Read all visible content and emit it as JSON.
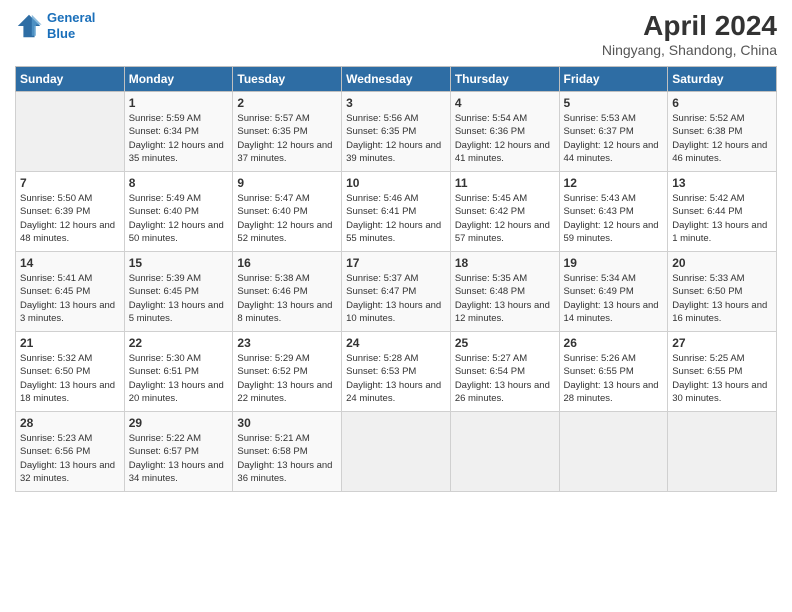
{
  "header": {
    "logo_line1": "General",
    "logo_line2": "Blue",
    "month_year": "April 2024",
    "location": "Ningyang, Shandong, China"
  },
  "weekdays": [
    "Sunday",
    "Monday",
    "Tuesday",
    "Wednesday",
    "Thursday",
    "Friday",
    "Saturday"
  ],
  "weeks": [
    [
      {
        "day": "",
        "empty": true
      },
      {
        "day": "1",
        "sunrise": "Sunrise: 5:59 AM",
        "sunset": "Sunset: 6:34 PM",
        "daylight": "Daylight: 12 hours and 35 minutes."
      },
      {
        "day": "2",
        "sunrise": "Sunrise: 5:57 AM",
        "sunset": "Sunset: 6:35 PM",
        "daylight": "Daylight: 12 hours and 37 minutes."
      },
      {
        "day": "3",
        "sunrise": "Sunrise: 5:56 AM",
        "sunset": "Sunset: 6:35 PM",
        "daylight": "Daylight: 12 hours and 39 minutes."
      },
      {
        "day": "4",
        "sunrise": "Sunrise: 5:54 AM",
        "sunset": "Sunset: 6:36 PM",
        "daylight": "Daylight: 12 hours and 41 minutes."
      },
      {
        "day": "5",
        "sunrise": "Sunrise: 5:53 AM",
        "sunset": "Sunset: 6:37 PM",
        "daylight": "Daylight: 12 hours and 44 minutes."
      },
      {
        "day": "6",
        "sunrise": "Sunrise: 5:52 AM",
        "sunset": "Sunset: 6:38 PM",
        "daylight": "Daylight: 12 hours and 46 minutes."
      }
    ],
    [
      {
        "day": "7",
        "sunrise": "Sunrise: 5:50 AM",
        "sunset": "Sunset: 6:39 PM",
        "daylight": "Daylight: 12 hours and 48 minutes."
      },
      {
        "day": "8",
        "sunrise": "Sunrise: 5:49 AM",
        "sunset": "Sunset: 6:40 PM",
        "daylight": "Daylight: 12 hours and 50 minutes."
      },
      {
        "day": "9",
        "sunrise": "Sunrise: 5:47 AM",
        "sunset": "Sunset: 6:40 PM",
        "daylight": "Daylight: 12 hours and 52 minutes."
      },
      {
        "day": "10",
        "sunrise": "Sunrise: 5:46 AM",
        "sunset": "Sunset: 6:41 PM",
        "daylight": "Daylight: 12 hours and 55 minutes."
      },
      {
        "day": "11",
        "sunrise": "Sunrise: 5:45 AM",
        "sunset": "Sunset: 6:42 PM",
        "daylight": "Daylight: 12 hours and 57 minutes."
      },
      {
        "day": "12",
        "sunrise": "Sunrise: 5:43 AM",
        "sunset": "Sunset: 6:43 PM",
        "daylight": "Daylight: 12 hours and 59 minutes."
      },
      {
        "day": "13",
        "sunrise": "Sunrise: 5:42 AM",
        "sunset": "Sunset: 6:44 PM",
        "daylight": "Daylight: 13 hours and 1 minute."
      }
    ],
    [
      {
        "day": "14",
        "sunrise": "Sunrise: 5:41 AM",
        "sunset": "Sunset: 6:45 PM",
        "daylight": "Daylight: 13 hours and 3 minutes."
      },
      {
        "day": "15",
        "sunrise": "Sunrise: 5:39 AM",
        "sunset": "Sunset: 6:45 PM",
        "daylight": "Daylight: 13 hours and 5 minutes."
      },
      {
        "day": "16",
        "sunrise": "Sunrise: 5:38 AM",
        "sunset": "Sunset: 6:46 PM",
        "daylight": "Daylight: 13 hours and 8 minutes."
      },
      {
        "day": "17",
        "sunrise": "Sunrise: 5:37 AM",
        "sunset": "Sunset: 6:47 PM",
        "daylight": "Daylight: 13 hours and 10 minutes."
      },
      {
        "day": "18",
        "sunrise": "Sunrise: 5:35 AM",
        "sunset": "Sunset: 6:48 PM",
        "daylight": "Daylight: 13 hours and 12 minutes."
      },
      {
        "day": "19",
        "sunrise": "Sunrise: 5:34 AM",
        "sunset": "Sunset: 6:49 PM",
        "daylight": "Daylight: 13 hours and 14 minutes."
      },
      {
        "day": "20",
        "sunrise": "Sunrise: 5:33 AM",
        "sunset": "Sunset: 6:50 PM",
        "daylight": "Daylight: 13 hours and 16 minutes."
      }
    ],
    [
      {
        "day": "21",
        "sunrise": "Sunrise: 5:32 AM",
        "sunset": "Sunset: 6:50 PM",
        "daylight": "Daylight: 13 hours and 18 minutes."
      },
      {
        "day": "22",
        "sunrise": "Sunrise: 5:30 AM",
        "sunset": "Sunset: 6:51 PM",
        "daylight": "Daylight: 13 hours and 20 minutes."
      },
      {
        "day": "23",
        "sunrise": "Sunrise: 5:29 AM",
        "sunset": "Sunset: 6:52 PM",
        "daylight": "Daylight: 13 hours and 22 minutes."
      },
      {
        "day": "24",
        "sunrise": "Sunrise: 5:28 AM",
        "sunset": "Sunset: 6:53 PM",
        "daylight": "Daylight: 13 hours and 24 minutes."
      },
      {
        "day": "25",
        "sunrise": "Sunrise: 5:27 AM",
        "sunset": "Sunset: 6:54 PM",
        "daylight": "Daylight: 13 hours and 26 minutes."
      },
      {
        "day": "26",
        "sunrise": "Sunrise: 5:26 AM",
        "sunset": "Sunset: 6:55 PM",
        "daylight": "Daylight: 13 hours and 28 minutes."
      },
      {
        "day": "27",
        "sunrise": "Sunrise: 5:25 AM",
        "sunset": "Sunset: 6:55 PM",
        "daylight": "Daylight: 13 hours and 30 minutes."
      }
    ],
    [
      {
        "day": "28",
        "sunrise": "Sunrise: 5:23 AM",
        "sunset": "Sunset: 6:56 PM",
        "daylight": "Daylight: 13 hours and 32 minutes."
      },
      {
        "day": "29",
        "sunrise": "Sunrise: 5:22 AM",
        "sunset": "Sunset: 6:57 PM",
        "daylight": "Daylight: 13 hours and 34 minutes."
      },
      {
        "day": "30",
        "sunrise": "Sunrise: 5:21 AM",
        "sunset": "Sunset: 6:58 PM",
        "daylight": "Daylight: 13 hours and 36 minutes."
      },
      {
        "day": "",
        "empty": true
      },
      {
        "day": "",
        "empty": true
      },
      {
        "day": "",
        "empty": true
      },
      {
        "day": "",
        "empty": true
      }
    ]
  ]
}
